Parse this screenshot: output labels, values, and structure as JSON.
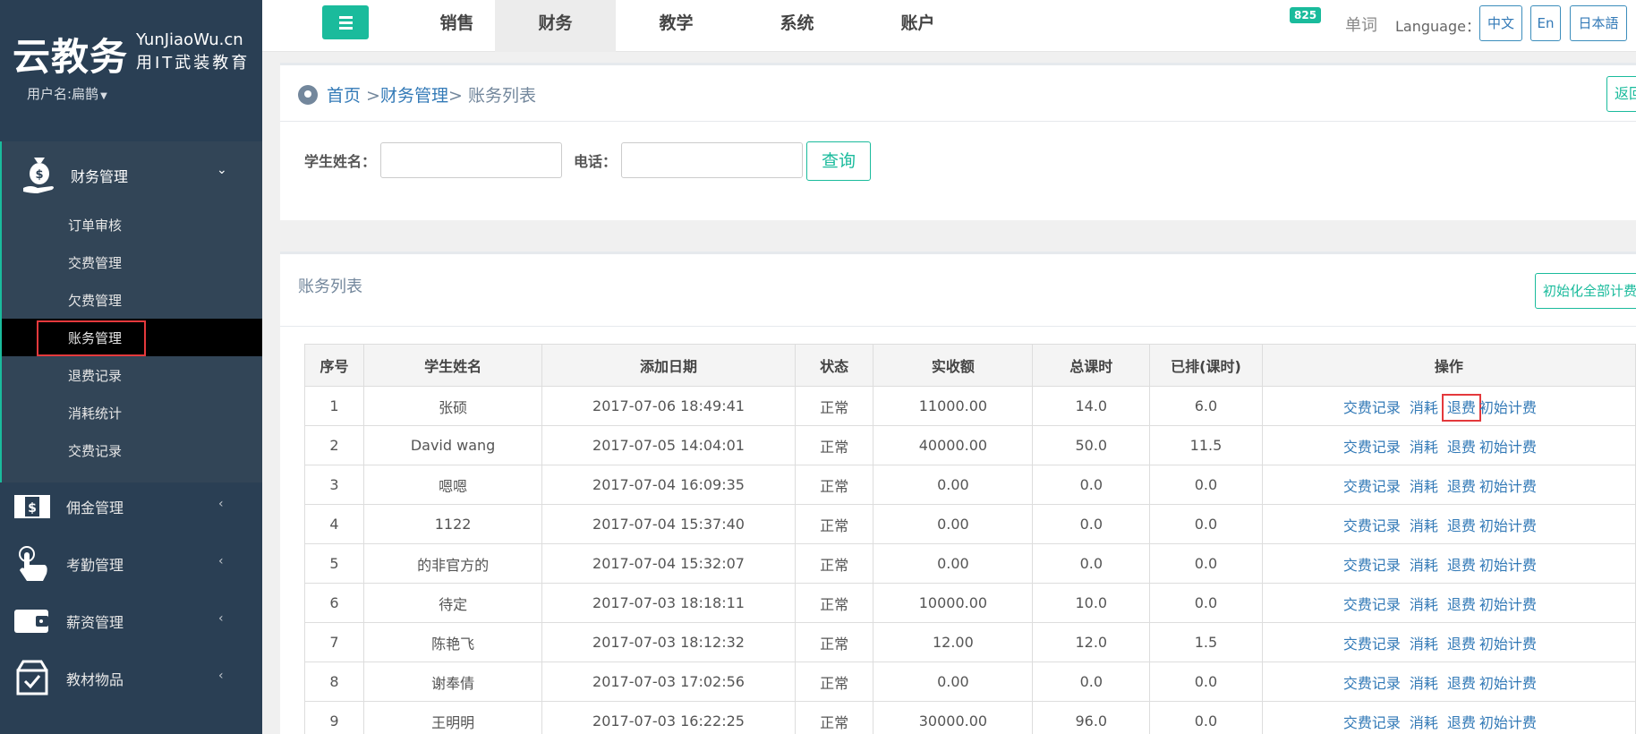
{
  "sidebar": {
    "logo_main": "云教务",
    "logo_en": "YunJiaoWu.cn",
    "logo_sub": "用IT武装教育",
    "user": "用户名:扁鹊",
    "active_group": {
      "label": "财务管理",
      "icon": "money-bag-icon"
    },
    "sub_items": [
      "订单审核",
      "交费管理",
      "欠费管理",
      "账务管理",
      "退费记录",
      "消耗统计",
      "交费记录"
    ],
    "groups": [
      {
        "label": "佣金管理",
        "icon": "cash-icon"
      },
      {
        "label": "考勤管理",
        "icon": "hand-touch-icon"
      },
      {
        "label": "薪资管理",
        "icon": "wallet-icon"
      },
      {
        "label": "教材物品",
        "icon": "box-icon"
      }
    ]
  },
  "topbar": {
    "tabs": [
      "销售",
      "财务",
      "教学",
      "系统",
      "账户"
    ],
    "active_tab": "财务",
    "badge_count": "825",
    "word": "单词",
    "language_label": "Language：",
    "languages": [
      "中文",
      "En",
      "日本語"
    ]
  },
  "breadcrumb": {
    "home": "首页",
    "sep1": " >",
    "section": "财务管理",
    "sep2": "> ",
    "current": "账务列表",
    "return_label": "返回"
  },
  "search": {
    "name_label": "学生姓名：",
    "phone_label": "电话：",
    "query_label": "查询"
  },
  "list": {
    "title": "账务列表",
    "init_all_label": "初始化全部计费",
    "headers": [
      "序号",
      "学生姓名",
      "添加日期",
      "状态",
      "实收额",
      "总课时",
      "已排(课时)",
      "操作"
    ],
    "ops": [
      "交费记录",
      "消耗",
      "退费",
      "初始计费"
    ],
    "rows": [
      [
        "1",
        "张硕",
        "2017-07-06 18:49:41",
        "正常",
        "11000.00",
        "14.0",
        "6.0"
      ],
      [
        "2",
        "David wang",
        "2017-07-05 14:04:01",
        "正常",
        "40000.00",
        "50.0",
        "11.5"
      ],
      [
        "3",
        "嗯嗯",
        "2017-07-04 16:09:35",
        "正常",
        "0.00",
        "0.0",
        "0.0"
      ],
      [
        "4",
        "1122",
        "2017-07-04 15:37:40",
        "正常",
        "0.00",
        "0.0",
        "0.0"
      ],
      [
        "5",
        "的非官方的",
        "2017-07-04 15:32:07",
        "正常",
        "0.00",
        "0.0",
        "0.0"
      ],
      [
        "6",
        "待定",
        "2017-07-03 18:18:11",
        "正常",
        "10000.00",
        "10.0",
        "0.0"
      ],
      [
        "7",
        "陈艳飞",
        "2017-07-03 18:12:32",
        "正常",
        "12.00",
        "12.0",
        "1.5"
      ],
      [
        "8",
        "谢奉倩",
        "2017-07-03 17:02:56",
        "正常",
        "0.00",
        "0.0",
        "0.0"
      ],
      [
        "9",
        "王明明",
        "2017-07-03 16:22:25",
        "正常",
        "30000.00",
        "96.0",
        "0.0"
      ]
    ]
  },
  "colors": {
    "sidebar": "#2a3f54",
    "accent": "#1abb9c",
    "link": "#337ab7",
    "highlight": "#e4393c"
  }
}
